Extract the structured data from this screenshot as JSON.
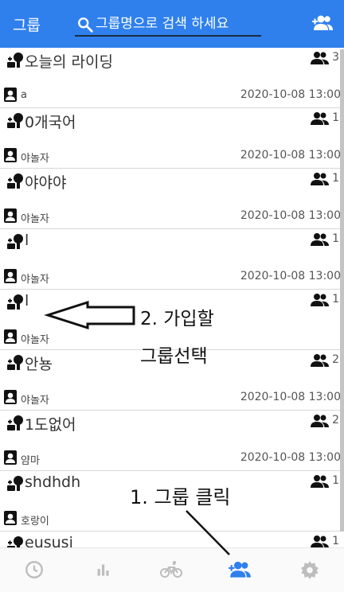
{
  "header": {
    "title": "그룹",
    "search_placeholder": "그룹명으로 검색 하세요"
  },
  "groups": [
    {
      "name": "오늘의 라이딩",
      "members": "3",
      "owner": "a",
      "created": "2020-10-08 13:00"
    },
    {
      "name": "0개국어",
      "members": "1",
      "owner": "야놀자",
      "created": "2020-10-08 13:00"
    },
    {
      "name": "야야야",
      "members": "1",
      "owner": "야놀자",
      "created": "2020-10-08 13:00"
    },
    {
      "name": "l",
      "members": "1",
      "owner": "야놀자",
      "created": "2020-10-08 13:00"
    },
    {
      "name": "l",
      "members": "1",
      "owner": "야놀자",
      "created": ""
    },
    {
      "name": "안뇽",
      "members": "2",
      "owner": "야놀자",
      "created": "2020-10-08 13:00"
    },
    {
      "name": "1도없어",
      "members": "2",
      "owner": "얌마",
      "created": "2020-10-08 13:00"
    },
    {
      "name": "shdhdh",
      "members": "1",
      "owner": "호랑이",
      "created": ""
    },
    {
      "name": "eususi",
      "members": "1",
      "owner": "",
      "created": ""
    }
  ],
  "bottom_nav": {
    "items": [
      "history-icon",
      "stats-icon",
      "bike-icon",
      "group-icon",
      "settings-icon"
    ],
    "active_index": 3
  },
  "annotations": {
    "arrow_label_line1": "2. 가입할",
    "arrow_label_line2": "그룹선택",
    "click_label": "1. 그룹 클릭"
  },
  "colors": {
    "header": "#2f80ed",
    "active_nav": "#2f80ed",
    "inactive_nav": "#bdbdbd"
  }
}
